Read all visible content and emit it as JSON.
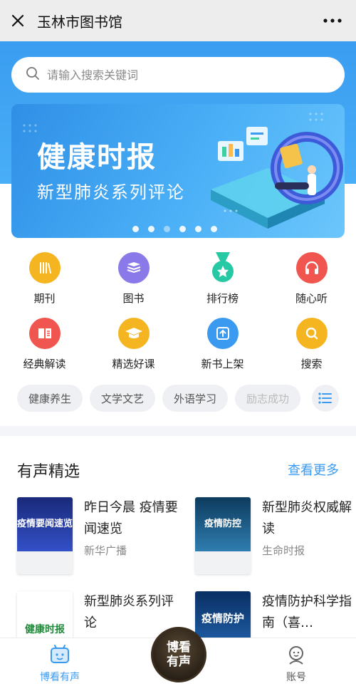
{
  "header": {
    "title": "玉林市图书馆"
  },
  "search": {
    "placeholder": "请输入搜索关键词"
  },
  "banner": {
    "title": "健康时报",
    "subtitle": "新型肺炎系列评论",
    "slide_count": 6,
    "active_slide": 3
  },
  "grid": [
    {
      "label": "期刊",
      "icon": "journal-icon",
      "color": "#f5b521"
    },
    {
      "label": "图书",
      "icon": "books-icon",
      "color": "#8a79e8"
    },
    {
      "label": "排行榜",
      "icon": "ranking-medal-icon",
      "color": "#27c9a5"
    },
    {
      "label": "随心听",
      "icon": "headphones-icon",
      "color": "#f0564f"
    },
    {
      "label": "经典解读",
      "icon": "open-book-icon",
      "color": "#f0564f"
    },
    {
      "label": "精选好课",
      "icon": "graduation-cap-icon",
      "color": "#f5b521"
    },
    {
      "label": "新书上架",
      "icon": "upload-shelf-icon",
      "color": "#3a9af0"
    },
    {
      "label": "搜索",
      "icon": "search-icon",
      "color": "#f5b521"
    }
  ],
  "chips": [
    "健康养生",
    "文学文艺",
    "外语学习",
    "励志成功"
  ],
  "section": {
    "title": "有声精选",
    "more": "查看更多",
    "items": [
      {
        "title": "昨日今晨 疫情要闻速览",
        "source": "新华广播",
        "cover_text": "疫情要闻速览",
        "cover_color": "#2a3d9e"
      },
      {
        "title": "新型肺炎权威解读",
        "source": "生命时报",
        "cover_text": "疫情防控",
        "cover_color": "#1e5d8a"
      },
      {
        "title": "新型肺炎系列评论",
        "source": "",
        "cover_text": "健康时报",
        "cover_color": "#ffffff"
      },
      {
        "title": "疫情防护科学指南（喜…",
        "source": "",
        "cover_text": "疫情防护",
        "cover_color": "#0f3f7a"
      }
    ]
  },
  "tabbar": {
    "home": "博看有声",
    "center": [
      "博看",
      "有声"
    ],
    "account": "账号",
    "active_color": "#3a9af0"
  }
}
